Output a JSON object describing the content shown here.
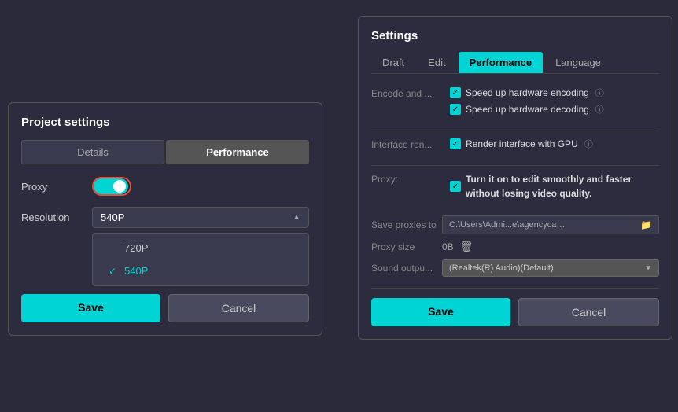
{
  "background_color": "#2a2a3a",
  "project_settings": {
    "title": "Project settings",
    "tabs": [
      {
        "id": "details",
        "label": "Details",
        "active": false
      },
      {
        "id": "performance",
        "label": "Performance",
        "active": true
      }
    ],
    "proxy_label": "Proxy",
    "proxy_enabled": true,
    "resolution_label": "Resolution",
    "resolution_value": "540P",
    "dropdown_items": [
      {
        "label": "720P",
        "selected": false
      },
      {
        "label": "540P",
        "selected": true
      }
    ],
    "save_label": "Save",
    "cancel_label": "Cancel"
  },
  "settings_panel": {
    "title": "Settings",
    "tabs": [
      {
        "id": "draft",
        "label": "Draft",
        "active": false
      },
      {
        "id": "edit",
        "label": "Edit",
        "active": false
      },
      {
        "id": "performance",
        "label": "Performance",
        "active": true
      },
      {
        "id": "language",
        "label": "Language",
        "active": false
      }
    ],
    "encode_label": "Encode and ...",
    "encode_options": [
      {
        "label": "Speed up hardware encoding",
        "checked": true
      },
      {
        "label": "Speed up hardware decoding",
        "checked": true
      }
    ],
    "interface_label": "Interface ren...",
    "interface_option": {
      "label": "Render interface with GPU",
      "checked": true
    },
    "proxy_label": "Proxy:",
    "proxy_description": "Turn it on to edit smoothly and faster without losing video quality.",
    "save_proxies_label": "Save proxies to",
    "save_proxies_path": "C:\\Users\\Admi...e\\agencycache",
    "proxy_size_label": "Proxy size",
    "proxy_size_value": "0B",
    "sound_output_label": "Sound outpu...",
    "sound_output_value": "(Realtek(R) Audio)(Default)",
    "save_label": "Save",
    "cancel_label": "Cancel"
  }
}
